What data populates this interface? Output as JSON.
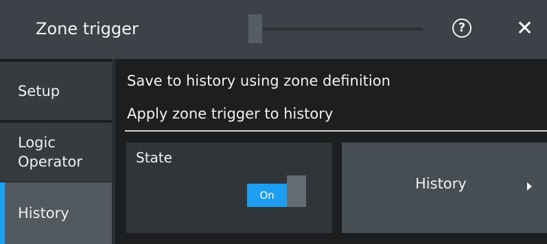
{
  "dialog": {
    "title": "Zone trigger",
    "help_icon": "question-circle-icon",
    "help_symbol": "?",
    "close_icon": "close-x-icon",
    "close_symbol": "✕"
  },
  "sidebar": {
    "items": [
      {
        "label": "Setup",
        "selected": false
      },
      {
        "label": "Logic\nOperator",
        "selected": false
      },
      {
        "label": "History",
        "selected": true
      }
    ]
  },
  "content": {
    "heading1": "Save to history using zone definition",
    "heading2": "Apply zone trigger to history",
    "state": {
      "label": "State",
      "value": "On"
    },
    "history_button": {
      "label": "History",
      "icon": "chevron-right-icon"
    }
  },
  "colors": {
    "accent": "#1ea0f0",
    "titlebar": "#3c4247",
    "background": "#1c1e20"
  }
}
